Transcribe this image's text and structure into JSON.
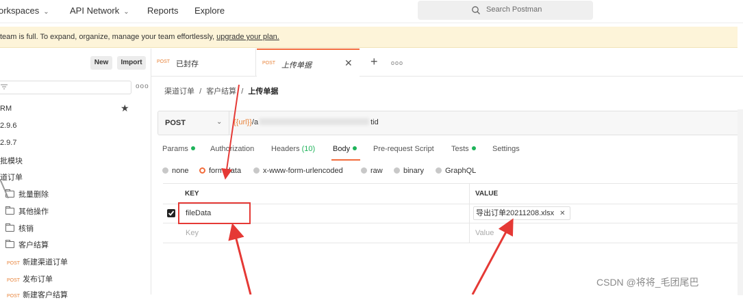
{
  "nav": {
    "workspaces": "orkspaces",
    "api_network": "API Network",
    "reports": "Reports",
    "explore": "Explore",
    "search_placeholder": "Search Postman"
  },
  "banner": {
    "text": "team is full. To expand, organize, manage your team effortlessly, ",
    "link": "upgrade your plan."
  },
  "sidebar": {
    "new_label": "New",
    "import_label": "Import",
    "more": "ooo",
    "items": [
      "RM",
      "2.9.6",
      "2.9.7",
      "批模块",
      "道订单",
      "批量删除",
      "其他操作",
      "核销",
      "客户结算",
      "新建渠道订单",
      "发布订单",
      "新建客户结算"
    ],
    "post_tag": "POST"
  },
  "tabs": [
    {
      "method": "POST",
      "name": "已封存"
    },
    {
      "method": "POST",
      "name": "上传单据"
    }
  ],
  "tab_more": "ooo",
  "breadcrumb": {
    "part1": "渠道订单",
    "sep": "/",
    "part2": "客户结算",
    "current": "上传单据"
  },
  "request": {
    "method": "POST",
    "url_var": "{{url}}",
    "url_a": "/a",
    "url_end": "tid"
  },
  "req_tabs": {
    "params": "Params",
    "authorization": "Authorization",
    "headers": "Headers",
    "headers_count": "(10)",
    "body": "Body",
    "prerequest": "Pre-request Script",
    "tests": "Tests",
    "settings": "Settings"
  },
  "body_types": [
    "none",
    "form-data",
    "x-www-form-urlencoded",
    "raw",
    "binary",
    "GraphQL"
  ],
  "body_selected": "form-data",
  "table": {
    "key_header": "KEY",
    "value_header": "VALUE",
    "row_key": "fileData",
    "row_value": "导出订单20211208.xlsx",
    "key_placeholder": "Key",
    "value_placeholder": "Value"
  },
  "watermark": "CSDN @将将_毛团尾巴",
  "colors": {
    "accent": "#f26b3a",
    "green": "#1eb35a",
    "annotation_red": "#e53935",
    "banner_bg": "#fdf4d9"
  }
}
